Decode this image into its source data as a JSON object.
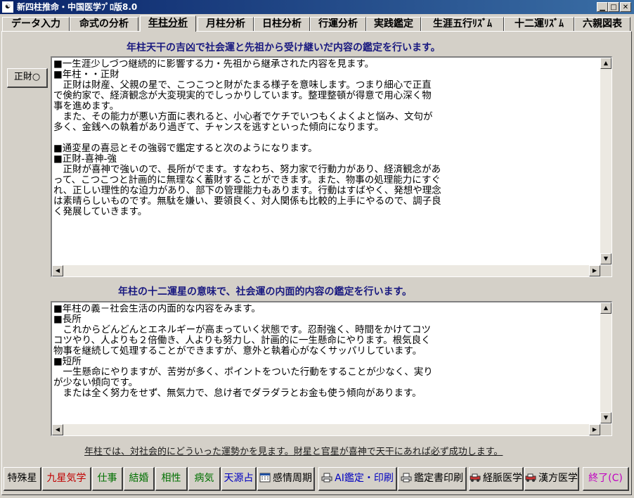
{
  "window": {
    "title": "新四柱推命・中国医学ﾌﾟﾛ版8.0",
    "app_icon": "app-icon"
  },
  "tabs": [
    {
      "label": "データ入力"
    },
    {
      "label": "命式の分析"
    },
    {
      "label": "年柱分析",
      "active": true
    },
    {
      "label": "月柱分析"
    },
    {
      "label": "日柱分析"
    },
    {
      "label": "行運分析"
    },
    {
      "label": "実践鑑定"
    },
    {
      "label": "生涯五行ﾘｽﾞﾑ"
    },
    {
      "label": "十二運ﾘｽﾞﾑ"
    },
    {
      "label": "六親図表"
    }
  ],
  "main": {
    "heading_top": "年柱天干の吉凶で社会運と先祖から受け継いだ内容の鑑定を行います。",
    "side_button_label": "正財○",
    "text_top": "■一生涯少しづつ継続的に影響する力・先祖から継承された内容を見ます。\n■年柱・・正財\n　正財は財産、父親の星で、こつこつと財がたまる様子を意味します。つまり細心で正直\nで倹約家で、経済観念が大変現実的でしっかりしています。整理整頓が得意で用心深く物\n事を進めます。\n　また、その能力が悪い方面に表れると、小心者でケチでいつもくよくよと悩み、文句が\n多く、金銭への執着があり過ぎて、チャンスを逃すといった傾向になります。\n\n■通変星の喜忌とその強弱で鑑定すると次のようになります。\n■正財-喜神-強\n　正財が喜神で強いので、長所がでます。すなわち、努力家で行動力があり、経済観念があ\nって、こつこつと計画的に無理なく蓄財することができます。また、物事の処理能力にすぐ\nれ、正しい理性的な迫力があり、部下の管理能力もあります。行動はすばやく、発想や理念\nは素晴らしいものです。無駄を嫌い、要領良く、対人関係も比較的上手にやるので、調子良\nく発展していきます。",
    "heading_bottom": "年柱の十二運星の意味で、社会運の内面的内容の鑑定を行います。",
    "text_bottom": "■年柱の義－社会生活の内面的な内容をみます。\n■長所\n　これからどんどんとエネルギーが高まっていく状態です。忍耐強く、時間をかけてコツ\nコツやり、人よりも２倍働き、人よりも努力し、計画的に一生懸命にやります。根気良く\n物事を継続して処理することができますが、意外と執着心がなくサッパリしています。\n■短所\n　一生懸命にやりますが、苦労が多く、ポイントをついた行動をすることが少なく、実り\nが少ない傾向です。\n　または全く努力をせず、無気力で、怠け者でダラダラとお金も使う傾向があります。",
    "footer_note": "年柱では、対社会的にどういった運勢かを見ます。財星と官星が喜神で天干にあれば必ず成功します。"
  },
  "bottom_buttons": [
    {
      "label": "特殊星",
      "color": "#000000"
    },
    {
      "label": "九星気学",
      "color": "#c00000"
    },
    {
      "label": "仕事",
      "color": "#007000"
    },
    {
      "label": "結婚",
      "color": "#007000"
    },
    {
      "label": "相性",
      "color": "#007000"
    },
    {
      "label": "病気",
      "color": "#007000"
    },
    {
      "label": "天源占",
      "color": "#0000c0"
    },
    {
      "label": "感情周期",
      "color": "#000000",
      "icon": "calendar-icon"
    },
    {
      "label": "AI鑑定・印刷",
      "color": "#0000c0",
      "icon": "printer-icon"
    },
    {
      "label": "鑑定書印刷",
      "color": "#000000",
      "icon": "printer-icon"
    },
    {
      "label": "経脈医学",
      "color": "#000000",
      "icon": "car-icon"
    },
    {
      "label": "漢方医学",
      "color": "#000000",
      "icon": "car-icon"
    },
    {
      "label": "終了(C)",
      "color": "#c000c0"
    }
  ]
}
